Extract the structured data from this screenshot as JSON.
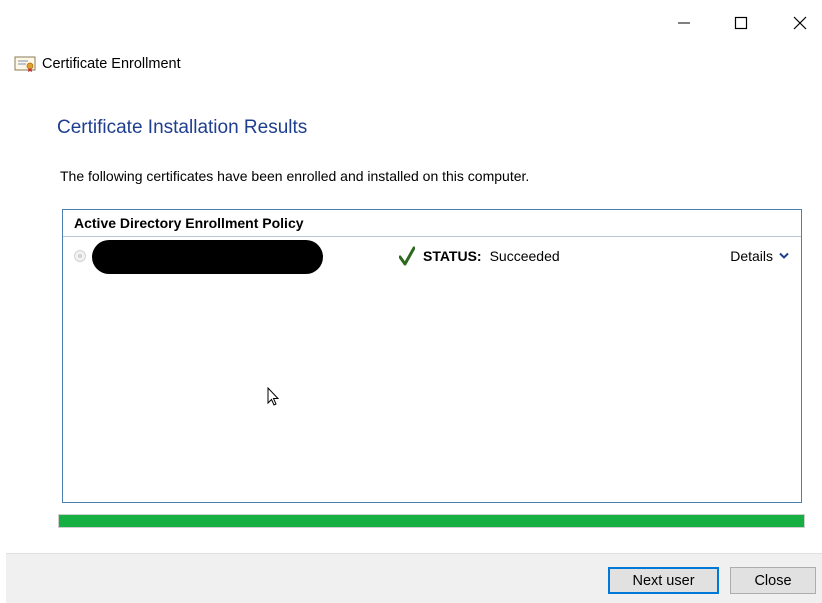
{
  "window": {
    "minimize_icon": "minimize-icon",
    "maximize_icon": "maximize-icon",
    "close_icon": "close-icon"
  },
  "app": {
    "title": "Certificate Enrollment",
    "icon": "certificate-icon"
  },
  "page": {
    "title": "Certificate Installation Results",
    "description": "The following certificates have been enrolled and installed on this computer."
  },
  "policy": {
    "name": "Active Directory Enrollment Policy",
    "certificates": [
      {
        "name": "",
        "status_label": "STATUS:",
        "status_value": "Succeeded",
        "status_icon": "checkmark-icon",
        "details_label": "Details",
        "details_icon": "chevron-down-icon"
      }
    ]
  },
  "progress": {
    "value": 1.0,
    "color": "#16b042"
  },
  "buttons": {
    "next_user": "Next user",
    "close": "Close"
  },
  "colors": {
    "title_blue": "#1e3f8f",
    "panel_border": "#4a7fb0"
  }
}
